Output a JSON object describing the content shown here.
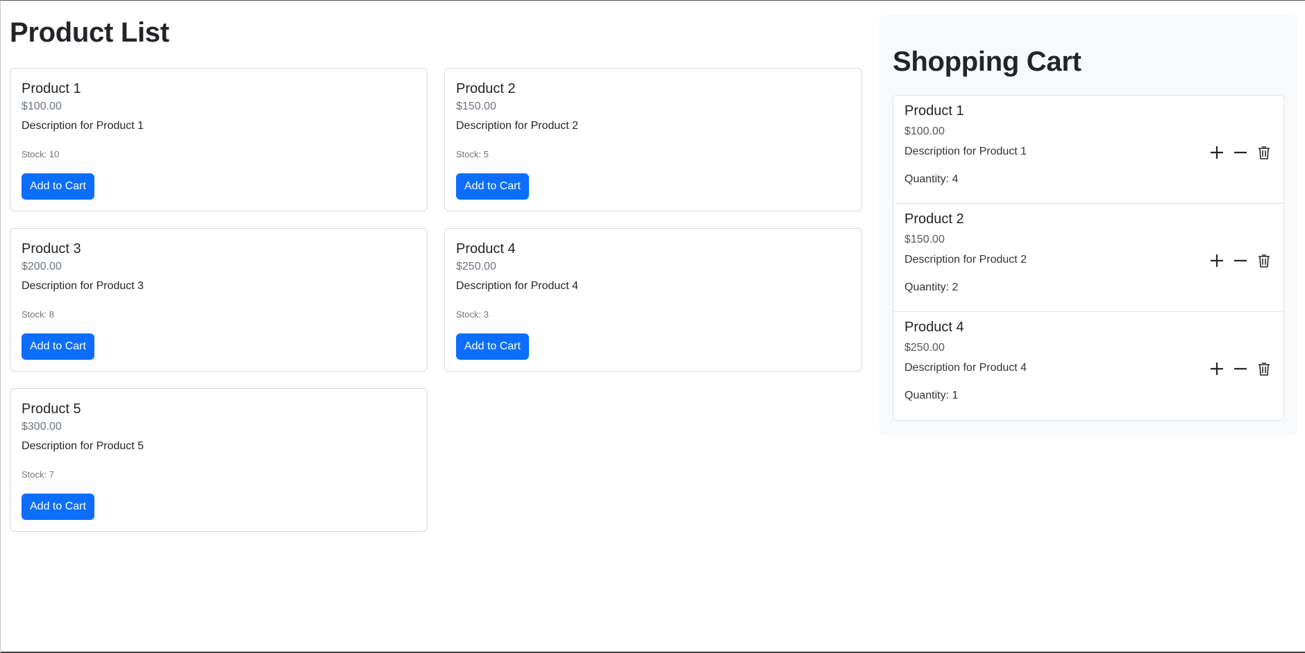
{
  "product_list": {
    "title": "Product List",
    "products": [
      {
        "name": "Product 1",
        "price": "$100.00",
        "description": "Description for Product 1",
        "stock": "Stock: 10",
        "button": "Add to Cart"
      },
      {
        "name": "Product 2",
        "price": "$150.00",
        "description": "Description for Product 2",
        "stock": "Stock: 5",
        "button": "Add to Cart"
      },
      {
        "name": "Product 3",
        "price": "$200.00",
        "description": "Description for Product 3",
        "stock": "Stock: 8",
        "button": "Add to Cart"
      },
      {
        "name": "Product 4",
        "price": "$250.00",
        "description": "Description for Product 4",
        "stock": "Stock: 3",
        "button": "Add to Cart"
      },
      {
        "name": "Product 5",
        "price": "$300.00",
        "description": "Description for Product 5",
        "stock": "Stock: 7",
        "button": "Add to Cart"
      }
    ]
  },
  "cart": {
    "title": "Shopping Cart",
    "items": [
      {
        "name": "Product 1",
        "price": "$100.00",
        "description": "Description for Product 1",
        "quantity": "Quantity: 4"
      },
      {
        "name": "Product 2",
        "price": "$150.00",
        "description": "Description for Product 2",
        "quantity": "Quantity: 2"
      },
      {
        "name": "Product 4",
        "price": "$250.00",
        "description": "Description for Product 4",
        "quantity": "Quantity: 1"
      }
    ],
    "item_actions": [
      "plus-icon",
      "minus-icon",
      "trash-icon"
    ]
  },
  "colors": {
    "primary": "#0d6efd",
    "cart_background": "#f8f9fa",
    "border": "#dee2e6",
    "muted_text": "#6c757d"
  }
}
